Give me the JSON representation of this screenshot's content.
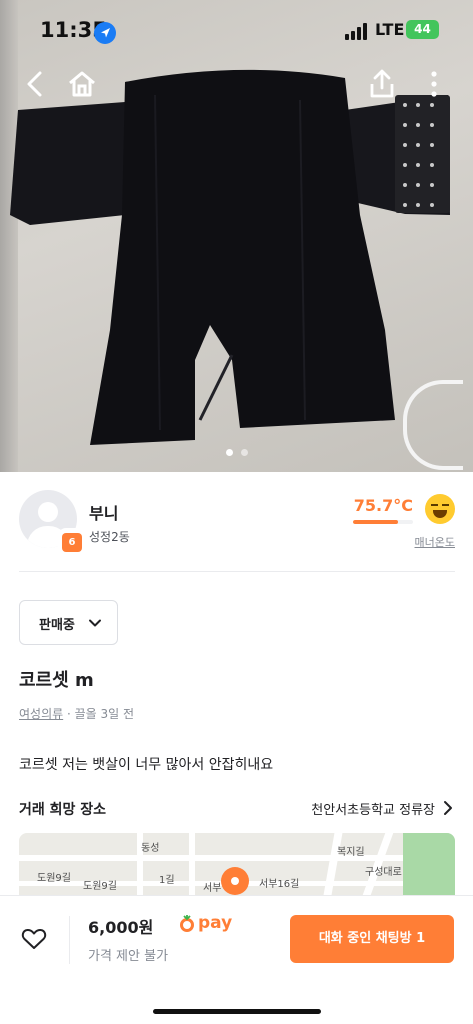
{
  "status_bar": {
    "time": "11:35",
    "network": "LTE",
    "battery": "44"
  },
  "top_nav": {
    "back_icon": "chevron-left-icon",
    "home_icon": "home-icon",
    "share_icon": "share-icon",
    "more_icon": "more-vertical-icon"
  },
  "image_carousel": {
    "total_images": 2,
    "current_index": 0
  },
  "seller": {
    "name": "부니",
    "location": "성정2동",
    "badge_number": "6",
    "manner_temp": "75.7°C",
    "manner_temp_level": 0.757,
    "manner_link": "매너온도"
  },
  "product": {
    "status": "판매중",
    "title": "코르셋 m",
    "category": "여성의류",
    "meta_separator": " · ",
    "time_ago": "끌올 3일 전",
    "description": "코르셋 저는 뱃살이 너무 많아서 안잡히내요"
  },
  "trade_place": {
    "label": "거래 희망 장소",
    "value": "천안서초등학교 정류장"
  },
  "map_labels": {
    "road1": "도원9길",
    "road2": "도원9길",
    "road3": "서부",
    "road4": "서부16길",
    "road5": "1길",
    "road6": "동성",
    "road7": "복지길",
    "road8": "구성대로"
  },
  "bottom_bar": {
    "price": "6,000원",
    "pay_label": "pay",
    "no_offer": "가격 제안 불가",
    "chat_button": "대화 중인 채팅방 1"
  },
  "colors": {
    "accent": "#ff7e36",
    "text_primary": "#212124",
    "text_secondary": "#868b94",
    "battery": "#43c55c",
    "location_blue": "#1a7cf5"
  }
}
